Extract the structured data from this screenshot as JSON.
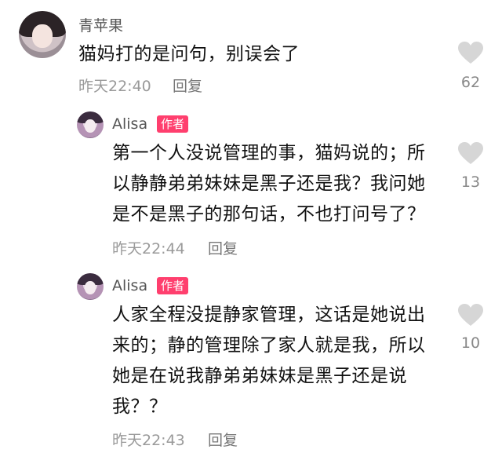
{
  "comments": [
    {
      "username": "青苹果",
      "text": "猫妈打的是问句，别误会了",
      "time": "昨天22:40",
      "reply": "回复",
      "likes": "62"
    }
  ],
  "replies": [
    {
      "username": "Alisa",
      "badge": "作者",
      "lines": [
        "第一个人没说管理的事，猫妈说的；所",
        "以静静弟弟妹妹是黑子还是我？我问她",
        "是不是黑子的那句话，不也打问号了？"
      ],
      "time": "昨天22:44",
      "reply": "回复",
      "likes": "13"
    },
    {
      "username": "Alisa",
      "badge": "作者",
      "lines": [
        "人家全程没提静家管理，这话是她说出",
        "来的；静的管理除了家人就是我，所以",
        "她是在说我静弟弟妹妹是黑子还是说",
        "我？？"
      ],
      "time": "昨天22:43",
      "reply": "回复",
      "likes": "10"
    }
  ],
  "colors": {
    "badge": "#ff3f6e",
    "heart": "#d6d6d6",
    "meta": "#9a9a9a"
  },
  "icons": {
    "like": "heart-icon"
  }
}
